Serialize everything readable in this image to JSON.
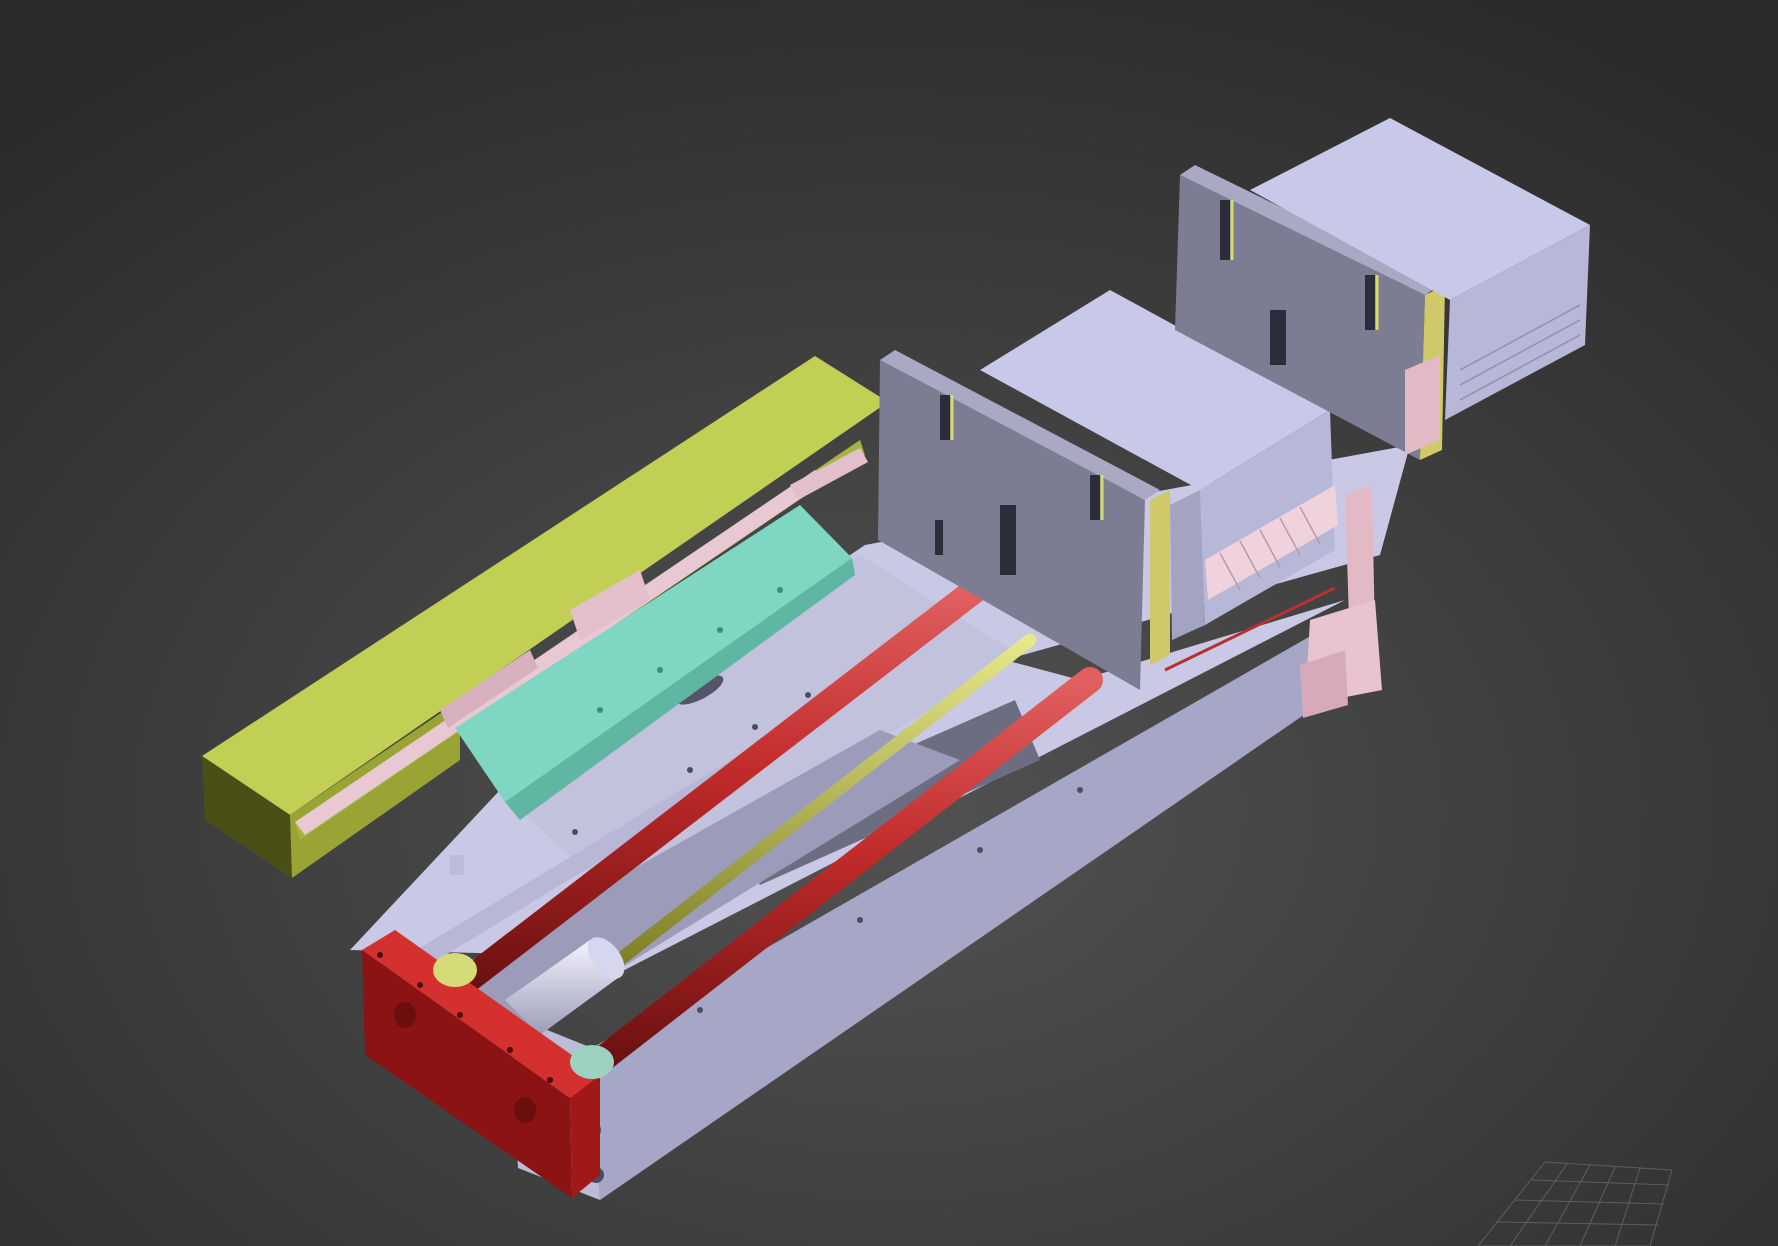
{
  "viewport": {
    "view_mode": "perspective",
    "shading": "smooth shaded",
    "background_gradient": [
      "#202020",
      "#505050"
    ]
  },
  "model": {
    "parts": [
      {
        "name": "base-frame",
        "color": "#c9c9e6"
      },
      {
        "name": "end-plate",
        "color": "#b82121"
      },
      {
        "name": "guide-rods",
        "color": "#c7302c"
      },
      {
        "name": "lead-screw",
        "color": "#bfc24a"
      },
      {
        "name": "air-cylinder",
        "color": "#cfcfe6"
      },
      {
        "name": "side-cover",
        "color": "#c2cf55"
      },
      {
        "name": "linear-rail",
        "color": "#e7c8d3"
      },
      {
        "name": "mounting-bracket",
        "color": "#7fd6c2"
      },
      {
        "name": "support-plate",
        "color": "#7a7a8e"
      },
      {
        "name": "comb-box",
        "color": "#c8c8e8"
      },
      {
        "name": "pink-bracket",
        "color": "#e3b9c6"
      }
    ]
  },
  "home_grid": {
    "color": "#6b6b6b"
  }
}
